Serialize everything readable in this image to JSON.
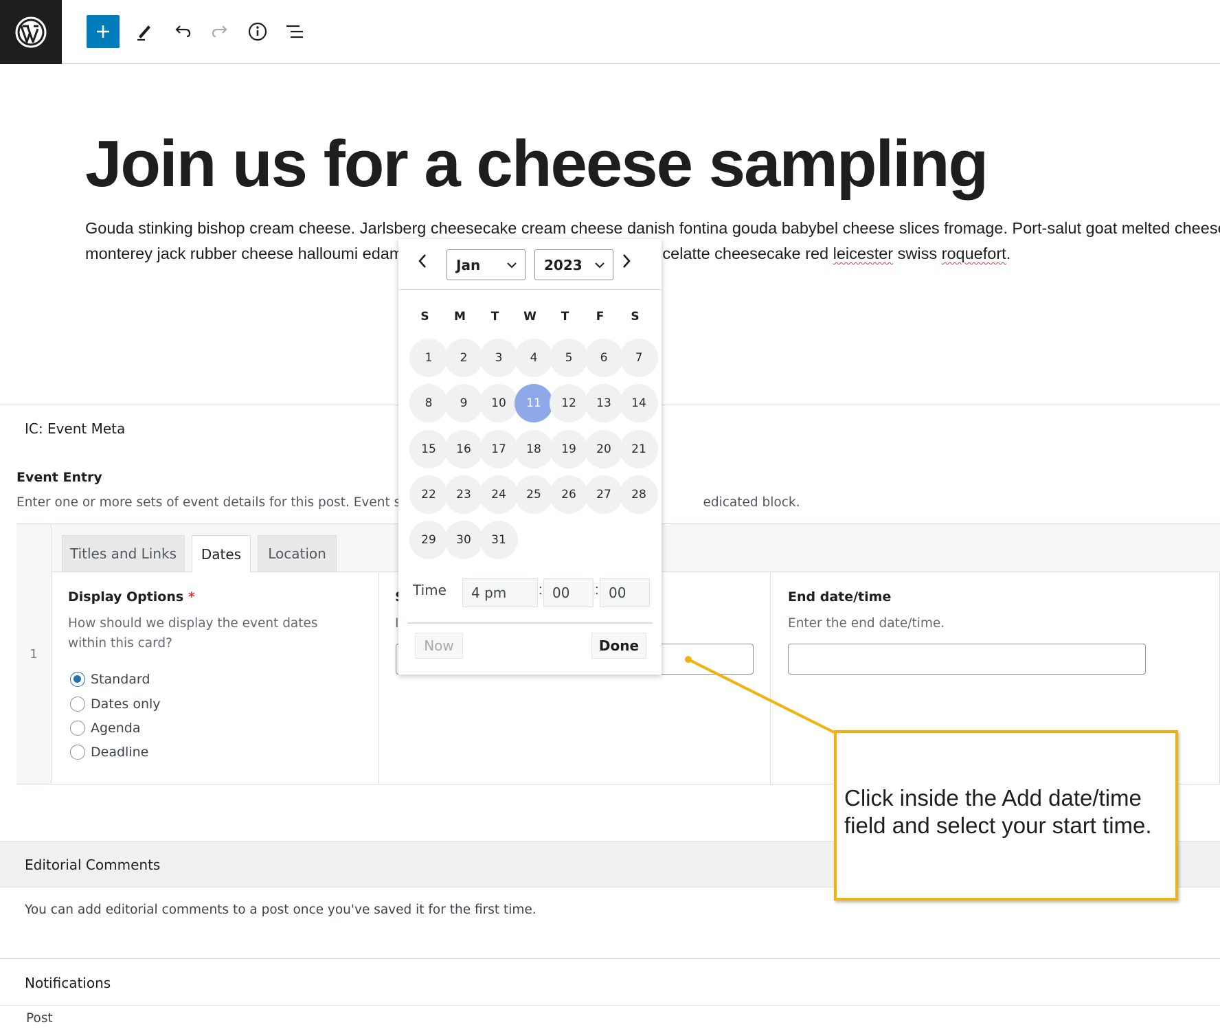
{
  "toolbar": {
    "icons": [
      "wordpress-logo",
      "plus-icon",
      "pencil-icon",
      "undo-icon",
      "redo-icon",
      "info-icon",
      "list-view-icon"
    ],
    "accent_color": "#007cba"
  },
  "post": {
    "title": "Join us for a cheese sampling",
    "body_line1": "Gouda stinking bishop cream cheese. Jarlsberg cheesecake cream cheese danish fontina gouda babybel cheese slices fromage. Port-salut goat melted cheese",
    "body_line2_a": "monterey jack rubber cheese halloumi edam",
    "body_line2_b": "celatte cheesecake red ",
    "body_line2_c": "leicester",
    "body_line2_d": " swiss ",
    "body_line2_e": "roquefort",
    "body_line2_f": "."
  },
  "metabox": {
    "title": "IC: Event Meta",
    "field_label": "Event Entry",
    "field_description_a": "Enter one or more sets of event details for this post. Event sectio",
    "field_description_b": "edicated block.",
    "row_number": "1",
    "tabs": [
      "Titles and Links",
      "Dates",
      "Location"
    ],
    "active_tab": "Dates",
    "display_options": {
      "label": "Display Options",
      "required_mark": "*",
      "description": "How should we display the event dates within this card?",
      "options": [
        "Standard",
        "Dates only",
        "Agenda",
        "Deadline"
      ],
      "selected": "Standard"
    },
    "start": {
      "label_partial": "S",
      "desc_partial": "I"
    },
    "end": {
      "label": "End date/time",
      "description": "Enter the end date/time.",
      "value": ""
    }
  },
  "datepicker": {
    "month": "Jan",
    "year": "2023",
    "weekdays": [
      "S",
      "M",
      "T",
      "W",
      "T",
      "F",
      "S"
    ],
    "days": [
      "1",
      "2",
      "3",
      "4",
      "5",
      "6",
      "7",
      "8",
      "9",
      "10",
      "11",
      "12",
      "13",
      "14",
      "15",
      "16",
      "17",
      "18",
      "19",
      "20",
      "21",
      "22",
      "23",
      "24",
      "25",
      "26",
      "27",
      "28",
      "29",
      "30",
      "31"
    ],
    "selected_day": "11",
    "time_label": "Time",
    "hour": "4 pm",
    "minute": "00",
    "second": "00",
    "separator": ":",
    "now_label": "Now",
    "done_label": "Done",
    "selected_color": "#8fa9e8"
  },
  "editorial": {
    "title": "Editorial Comments",
    "text": "You can add editorial comments to a post once you've saved it for the first time."
  },
  "notifications": {
    "title": "Notifications",
    "text": "Post"
  },
  "callout": {
    "text": "Click inside the Add date/time field and select your start time.",
    "border_color": "#f2b10f"
  }
}
